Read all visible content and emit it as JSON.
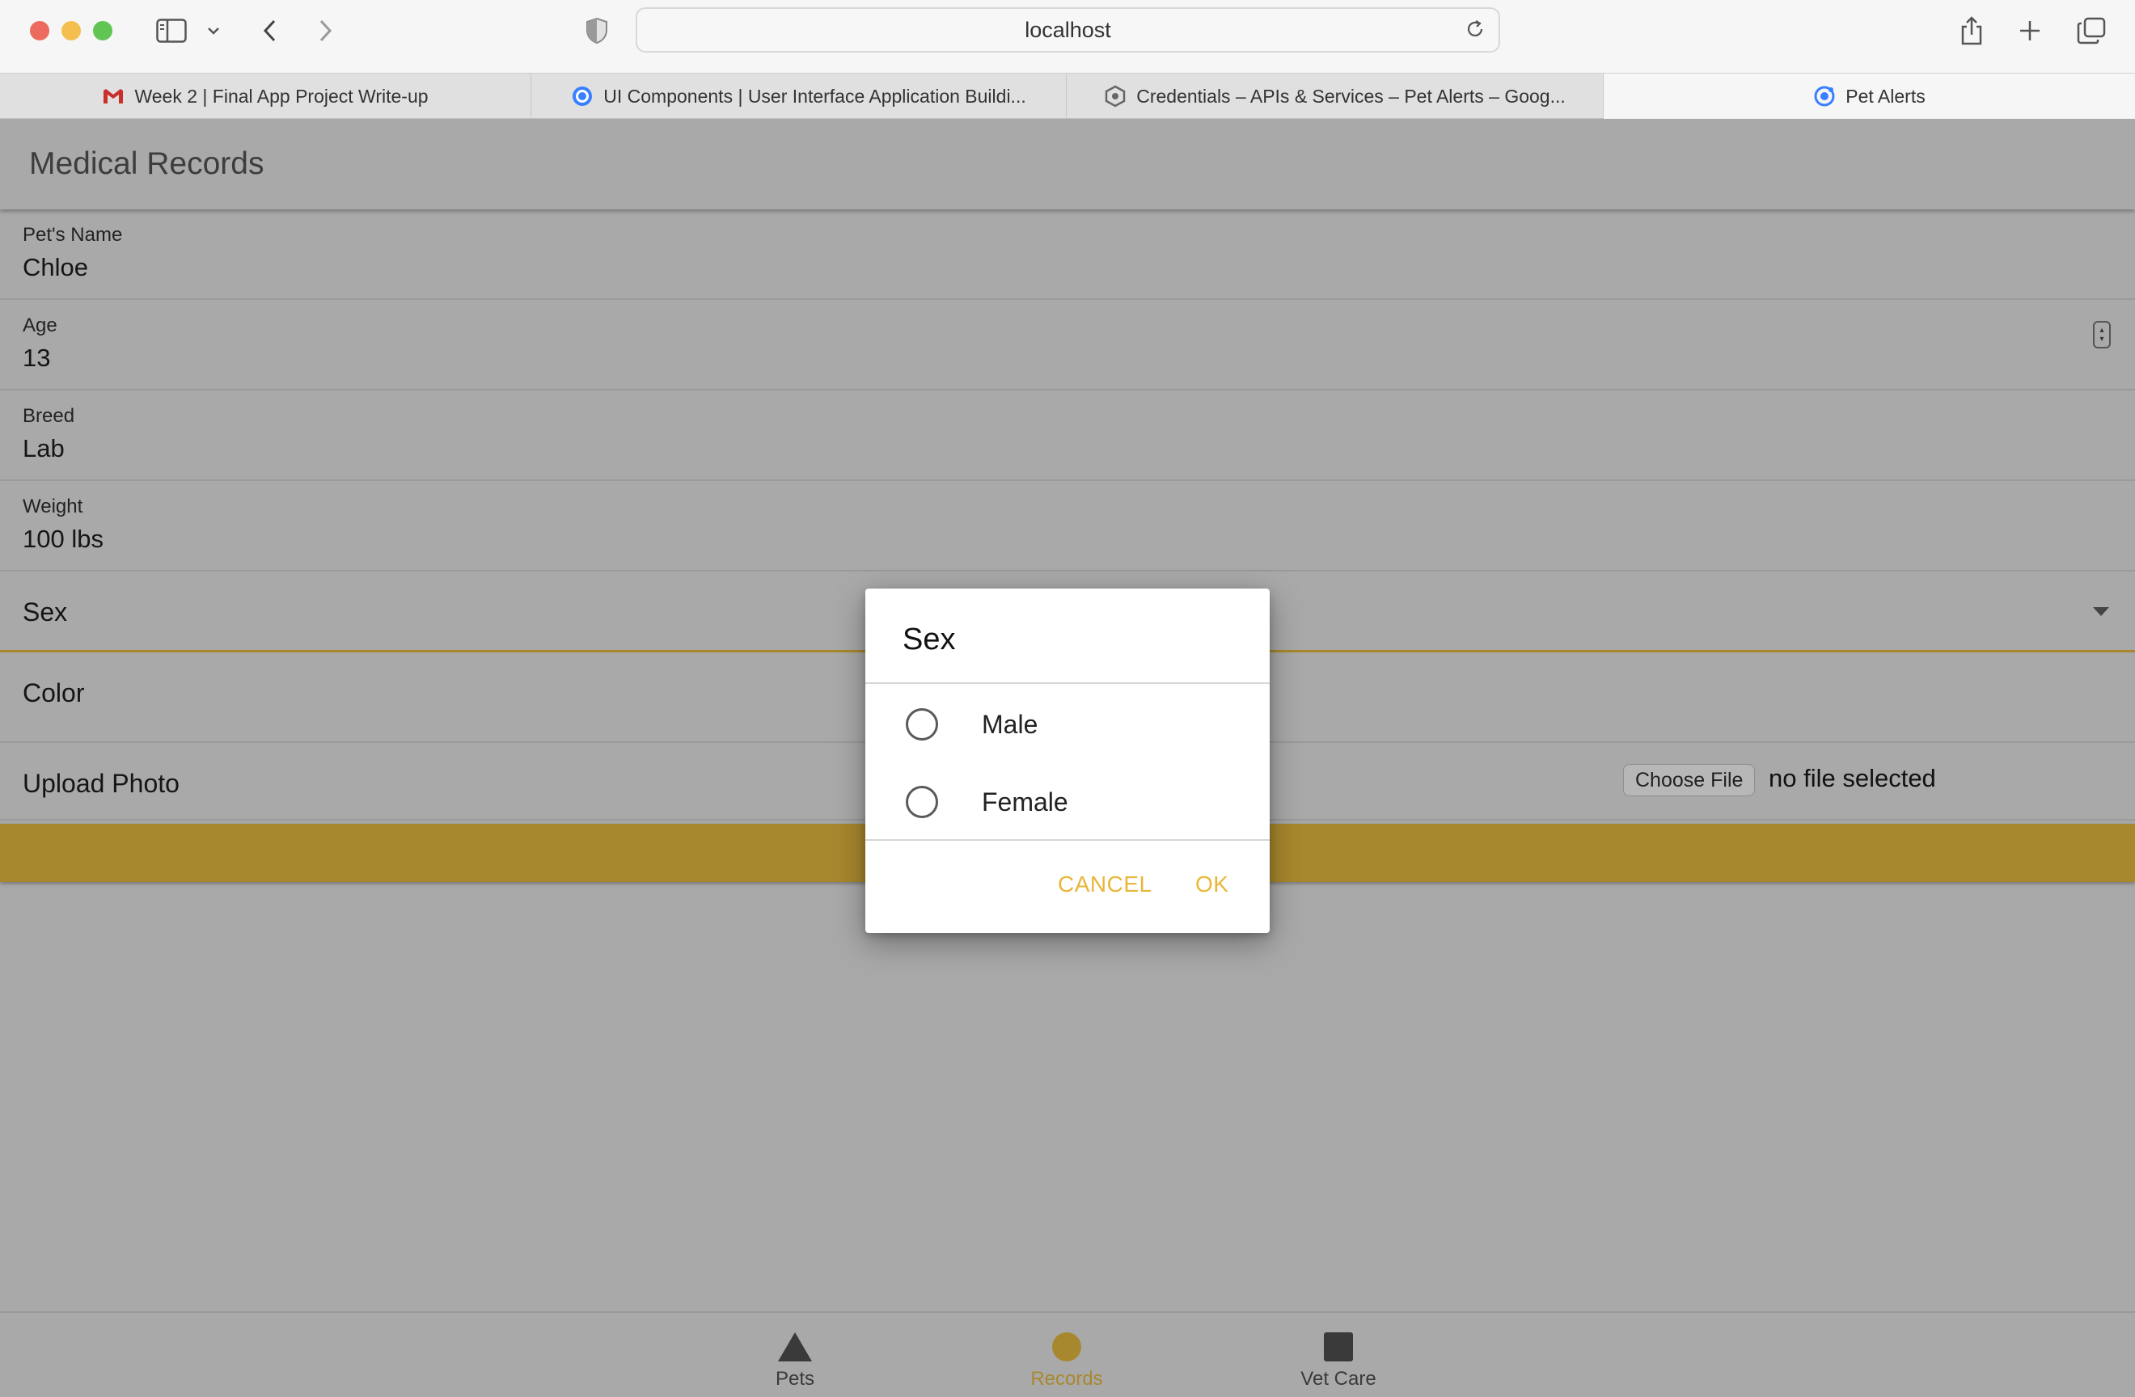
{
  "browser": {
    "url": "localhost",
    "tabs": [
      {
        "title": "Week 2 | Final App Project Write-up",
        "icon": "gmail-icon"
      },
      {
        "title": "UI Components | User Interface Application Buildi...",
        "icon": "ionic-icon"
      },
      {
        "title": "Credentials – APIs & Services – Pet Alerts – Goog...",
        "icon": "gcp-icon"
      },
      {
        "title": "Pet Alerts",
        "icon": "ionic-icon",
        "active": true
      }
    ]
  },
  "header": {
    "title": "Medical Records"
  },
  "form": {
    "pet_name": {
      "label": "Pet's Name",
      "value": "Chloe"
    },
    "age": {
      "label": "Age",
      "value": "13"
    },
    "breed": {
      "label": "Breed",
      "value": "Lab"
    },
    "weight": {
      "label": "Weight",
      "value": "100 lbs"
    },
    "sex": {
      "label": "Sex"
    },
    "color": {
      "label": "Color"
    },
    "upload": {
      "label": "Upload Photo",
      "button": "Choose File",
      "status": "no file selected"
    }
  },
  "dialog": {
    "title": "Sex",
    "options": [
      "Male",
      "Female"
    ],
    "cancel": "CANCEL",
    "ok": "OK"
  },
  "tabbar": {
    "items": [
      {
        "label": "Pets",
        "icon": "triangle-icon"
      },
      {
        "label": "Records",
        "icon": "circle-icon",
        "active": true
      },
      {
        "label": "Vet Care",
        "icon": "square-icon"
      }
    ]
  },
  "colors": {
    "accent": "#a8882e",
    "dialog_button": "#e9b63a",
    "backdrop": "#a9a9a9"
  }
}
